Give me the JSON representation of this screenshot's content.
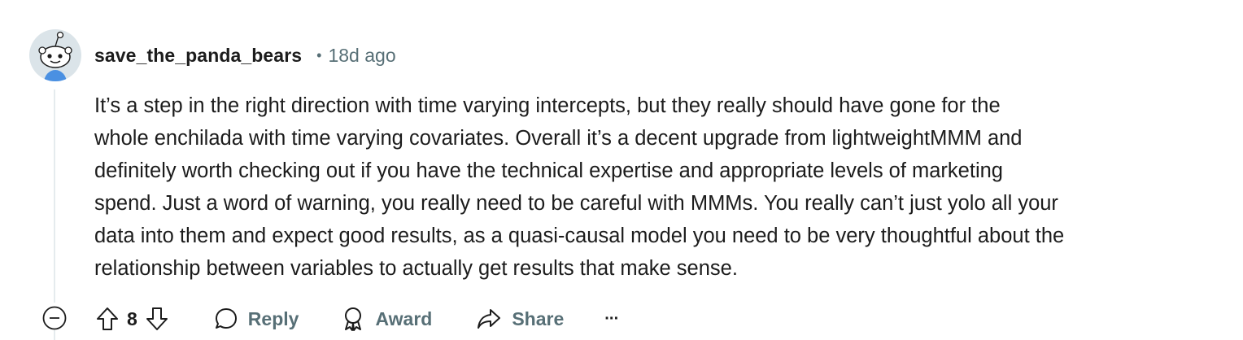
{
  "comment": {
    "author": "save_the_panda_bears",
    "separator": "•",
    "age": "18d ago",
    "body_lines": [
      "It’s a step in the right direction with time varying intercepts, but they really should have gone for the",
      "whole enchilada with time varying covariates. Overall it’s a decent upgrade from lightweightMMM and",
      "definitely worth checking out if you have the technical expertise and appropriate levels of marketing",
      "spend. Just a word of warning, you really need to be careful with MMMs. You really can’t just yolo all your",
      "data into them and expect good results, as a quasi-causal model you need to be very thoughtful about the",
      "relationship between variables to actually get results that make sense."
    ]
  },
  "actions": {
    "score": "8",
    "reply_label": "Reply",
    "award_label": "Award",
    "share_label": "Share",
    "more_label": "···"
  },
  "icons": {
    "avatar": "snoo-avatar-icon",
    "collapse": "collapse-minus-icon",
    "upvote": "upvote-arrow-icon",
    "downvote": "downvote-arrow-icon",
    "reply": "speech-bubble-icon",
    "award": "award-medal-icon",
    "share": "share-arrow-icon",
    "more": "ellipsis-icon"
  },
  "colors": {
    "text": "#1c1c1c",
    "muted": "#576f76",
    "thread": "#e5ebee",
    "avatar_bg": "#dbe4e9"
  }
}
